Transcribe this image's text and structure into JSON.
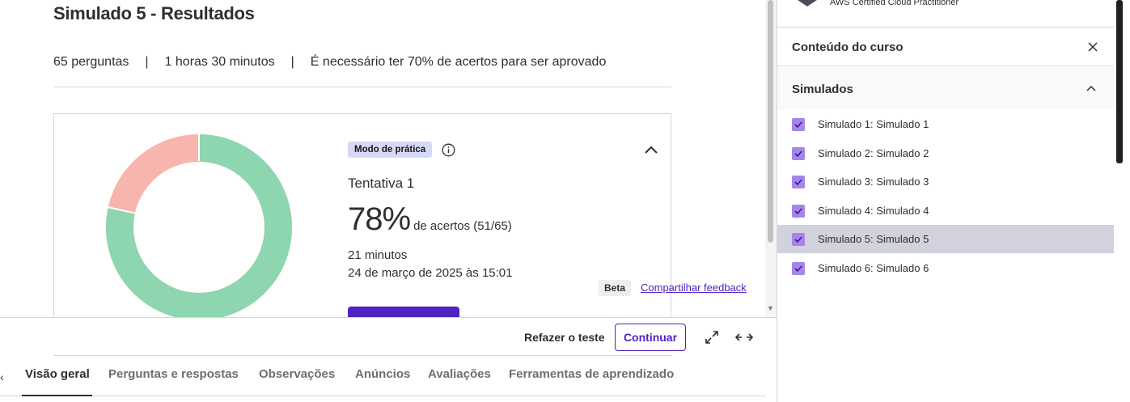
{
  "page": {
    "title": "Simulado 5 - Resultados",
    "meta": {
      "questions": "65 perguntas",
      "duration": "1 horas 30 minutos",
      "pass_rule": "É necessário ter 70% de acertos para ser aprovado",
      "separator": "|"
    }
  },
  "result": {
    "mode_badge": "Modo de prática",
    "attempt": "Tentativa 1",
    "score_percent": "78%",
    "score_detail": "de acertos (51/65)",
    "time_spent": "21 minutos",
    "date": "24 de março de 2025 às 15:01",
    "correct": 51,
    "total": 65,
    "colors": {
      "correct": "#8ed6b0",
      "incorrect": "#f7b5ad",
      "accent": "#5022c3"
    }
  },
  "feedback": {
    "beta": "Beta",
    "link": "Compartilhar feedback"
  },
  "toolbar": {
    "retake": "Refazer o teste",
    "continue": "Continuar"
  },
  "tabs": [
    {
      "label": "Visão geral",
      "active": true
    },
    {
      "label": "Perguntas e respostas"
    },
    {
      "label": "Observações"
    },
    {
      "label": "Anúncios"
    },
    {
      "label": "Avaliações"
    },
    {
      "label": "Ferramentas de aprendizado"
    }
  ],
  "sidebar": {
    "course_name": "AWS Certified Cloud Practitioner",
    "content_title": "Conteúdo do curso",
    "section_title": "Simulados",
    "lessons": [
      {
        "title": "Simulado 1: Simulado 1",
        "completed": true
      },
      {
        "title": "Simulado 2: Simulado 2",
        "completed": true
      },
      {
        "title": "Simulado 3: Simulado 3",
        "completed": true
      },
      {
        "title": "Simulado 4: Simulado 4",
        "completed": true
      },
      {
        "title": "Simulado 5: Simulado 5",
        "completed": true,
        "current": true
      },
      {
        "title": "Simulado 6: Simulado 6",
        "completed": true
      }
    ]
  }
}
